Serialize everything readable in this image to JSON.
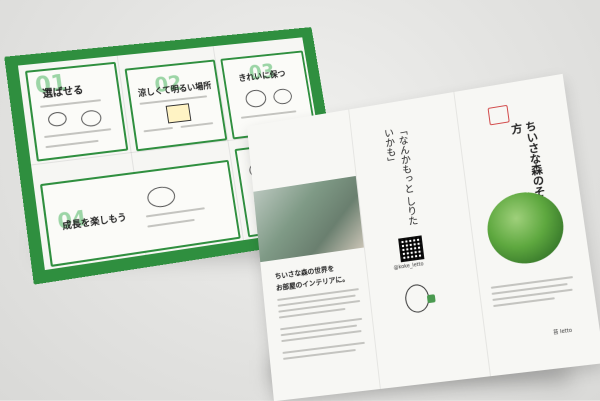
{
  "colors": {
    "brand_green": "#2f8f3f",
    "light_green_numbers": "#7dc98b",
    "paper": "#f6f6f3",
    "background": "#e4e4e2"
  },
  "green_brochure": {
    "panels": [
      {
        "number": "01",
        "title": "選ばせる"
      },
      {
        "number": "02",
        "title": "涼しくて明るい場所"
      },
      {
        "number": "03",
        "title": "きれいに保つ"
      },
      {
        "number": "04",
        "title": "成長を楽しもう"
      }
    ]
  },
  "white_brochure": {
    "quote": "「なんかもっと しりたいかも」",
    "instagram_handle": "@koke_letto",
    "cover_title": "ちいさな森のそだて方",
    "intro_heading_line1": "ちいさな森の世界を",
    "intro_heading_line2": "お部屋のインテリアに。",
    "brand_mark": "苔 letto"
  }
}
